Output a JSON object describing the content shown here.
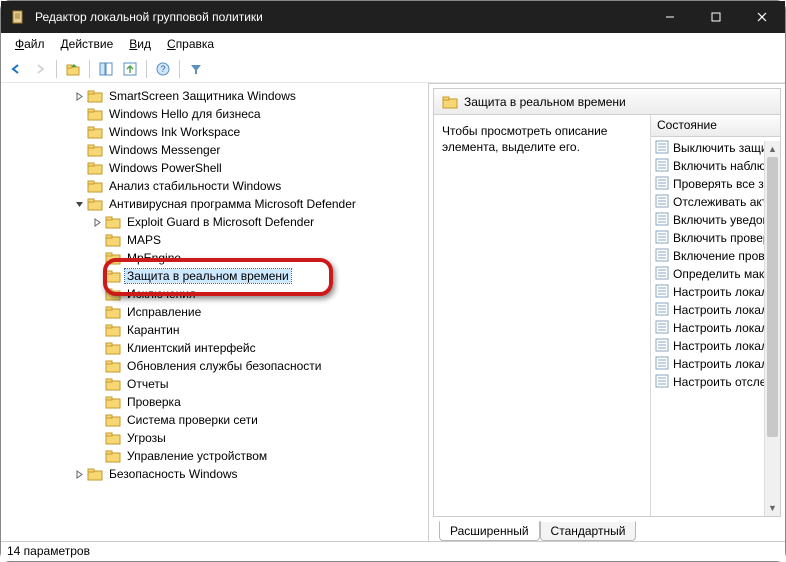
{
  "window": {
    "title": "Редактор локальной групповой политики"
  },
  "menu": {
    "file": "Файл",
    "action": "Действие",
    "view": "Вид",
    "help": "Справка"
  },
  "tree": {
    "items": [
      {
        "indent": 4,
        "expander": "right",
        "label": "SmartScreen Защитника Windows"
      },
      {
        "indent": 4,
        "expander": "",
        "label": "Windows Hello для бизнеса"
      },
      {
        "indent": 4,
        "expander": "",
        "label": "Windows Ink Workspace"
      },
      {
        "indent": 4,
        "expander": "",
        "label": "Windows Messenger"
      },
      {
        "indent": 4,
        "expander": "",
        "label": "Windows PowerShell"
      },
      {
        "indent": 4,
        "expander": "",
        "label": "Анализ стабильности Windows"
      },
      {
        "indent": 4,
        "expander": "down",
        "label": "Антивирусная программа Microsoft Defender"
      },
      {
        "indent": 5,
        "expander": "right",
        "label": "Exploit Guard в Microsoft Defender"
      },
      {
        "indent": 5,
        "expander": "",
        "label": "MAPS"
      },
      {
        "indent": 5,
        "expander": "",
        "label": "MpEngine"
      },
      {
        "indent": 5,
        "expander": "",
        "label": "Защита в реальном времени",
        "selected": true
      },
      {
        "indent": 5,
        "expander": "",
        "label": "Исключения"
      },
      {
        "indent": 5,
        "expander": "",
        "label": "Исправление"
      },
      {
        "indent": 5,
        "expander": "",
        "label": "Карантин"
      },
      {
        "indent": 5,
        "expander": "",
        "label": "Клиентский интерфейс"
      },
      {
        "indent": 5,
        "expander": "",
        "label": "Обновления службы безопасности"
      },
      {
        "indent": 5,
        "expander": "",
        "label": "Отчеты"
      },
      {
        "indent": 5,
        "expander": "",
        "label": "Проверка"
      },
      {
        "indent": 5,
        "expander": "",
        "label": "Система проверки сети"
      },
      {
        "indent": 5,
        "expander": "",
        "label": "Угрозы"
      },
      {
        "indent": 5,
        "expander": "",
        "label": "Управление устройством"
      },
      {
        "indent": 4,
        "expander": "right",
        "label": "Безопасность Windows"
      }
    ]
  },
  "right": {
    "header": "Защита в реальном времени",
    "description": "Чтобы просмотреть описание элемента, выделите его.",
    "column_header": "Состояние",
    "policies": [
      "Выключить защиту",
      "Включить наблюде",
      "Проверять все загру",
      "Отслеживать активн",
      "Включить уведомле",
      "Включить проверку",
      "Включение провер",
      "Определить максим",
      "Настроить локальн",
      "Настроить локальн",
      "Настроить локальн",
      "Настроить локальн",
      "Настроить локальн",
      "Настроить отслежи"
    ]
  },
  "tabs": {
    "extended": "Расширенный",
    "standard": "Стандартный"
  },
  "statusbar": "14 параметров"
}
